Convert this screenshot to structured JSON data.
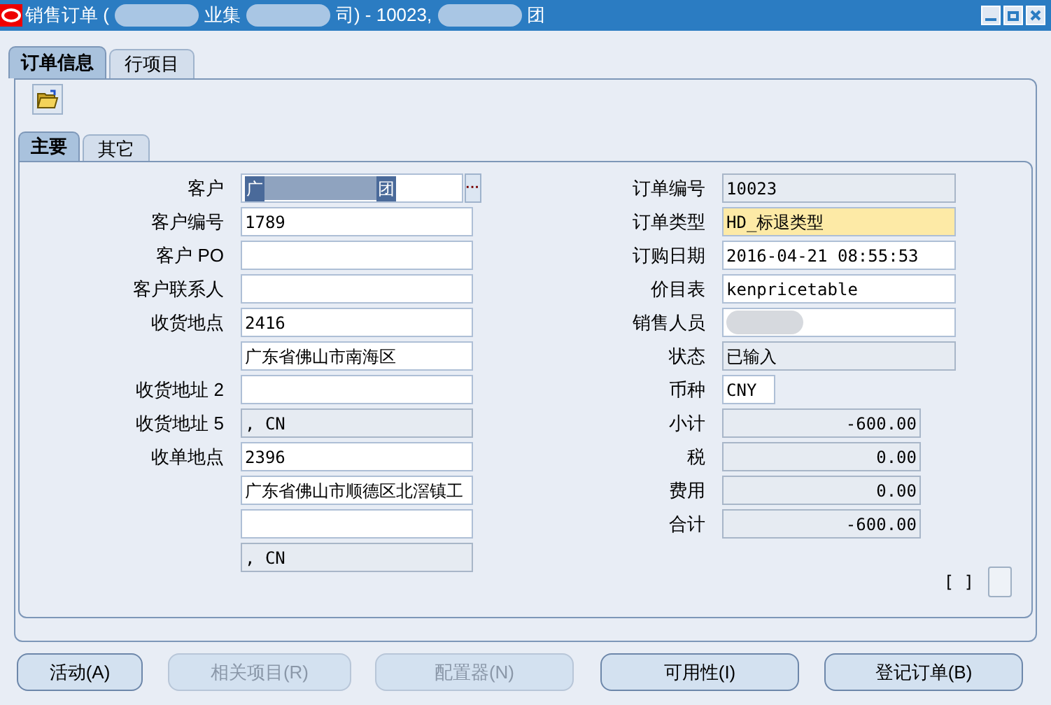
{
  "window": {
    "title_parts": [
      "销售订单 (",
      "业集",
      "司) - 10023,",
      "团"
    ]
  },
  "tabs": [
    {
      "label": "订单信息",
      "selected": true
    },
    {
      "label": "行项目",
      "selected": false
    }
  ],
  "subtabs": [
    {
      "label": "主要",
      "selected": true
    },
    {
      "label": "其它",
      "selected": false
    }
  ],
  "left_fields": [
    {
      "label": "客户",
      "value_parts": [
        "广",
        "团"
      ],
      "kind": "selected",
      "lov_button": "···"
    },
    {
      "label": "客户编号",
      "value": "1789",
      "kind": "editable"
    },
    {
      "label": "客户 PO",
      "kind": "editable"
    },
    {
      "label": "客户联系人",
      "kind": "editable"
    },
    {
      "label": "收货地点",
      "value": "2416",
      "kind": "editable"
    },
    {
      "value": "广东省佛山市南海区",
      "kind": "editable"
    },
    {
      "label": "收货地址 2",
      "kind": "editable"
    },
    {
      "label": "收货地址 5",
      "value": ", CN",
      "kind": "readonly"
    },
    {
      "label": "收单地点",
      "value": "2396",
      "kind": "editable"
    },
    {
      "value": "广东省佛山市顺德区北滘镇工",
      "kind": "editable"
    },
    {
      "kind": "editable"
    },
    {
      "value": ", CN",
      "kind": "readonly"
    }
  ],
  "right_fields": [
    {
      "label": "订单编号",
      "value": "10023",
      "kind": "readonly"
    },
    {
      "label": "订单类型",
      "value": "HD_标退类型",
      "kind": "required"
    },
    {
      "label": "订购日期",
      "value": "2016-04-21 08:55:53",
      "kind": "editable"
    },
    {
      "label": "价目表",
      "value": "kenpricetable",
      "kind": "editable"
    },
    {
      "label": "销售人员",
      "kind": "redacted"
    },
    {
      "label": "状态",
      "value": "已输入",
      "kind": "readonly"
    },
    {
      "label": "币种",
      "value": "CNY",
      "kind": "short"
    },
    {
      "label": "小计",
      "value": "-600.00",
      "kind": "amount"
    },
    {
      "label": "税",
      "value": "0.00",
      "kind": "amount"
    },
    {
      "label": "费用",
      "value": "0.00",
      "kind": "amount"
    },
    {
      "label": "合计",
      "value": "-600.00",
      "kind": "amount"
    }
  ],
  "flex_field": {
    "label": "[ ]"
  },
  "buttons": [
    {
      "label": "活动(A)",
      "disabled": false
    },
    {
      "label": "相关项目(R)",
      "disabled": true
    },
    {
      "label": "配置器(N)",
      "disabled": true
    },
    {
      "label": "可用性(I)",
      "disabled": false
    },
    {
      "label": "登记订单(B)",
      "disabled": false
    }
  ]
}
